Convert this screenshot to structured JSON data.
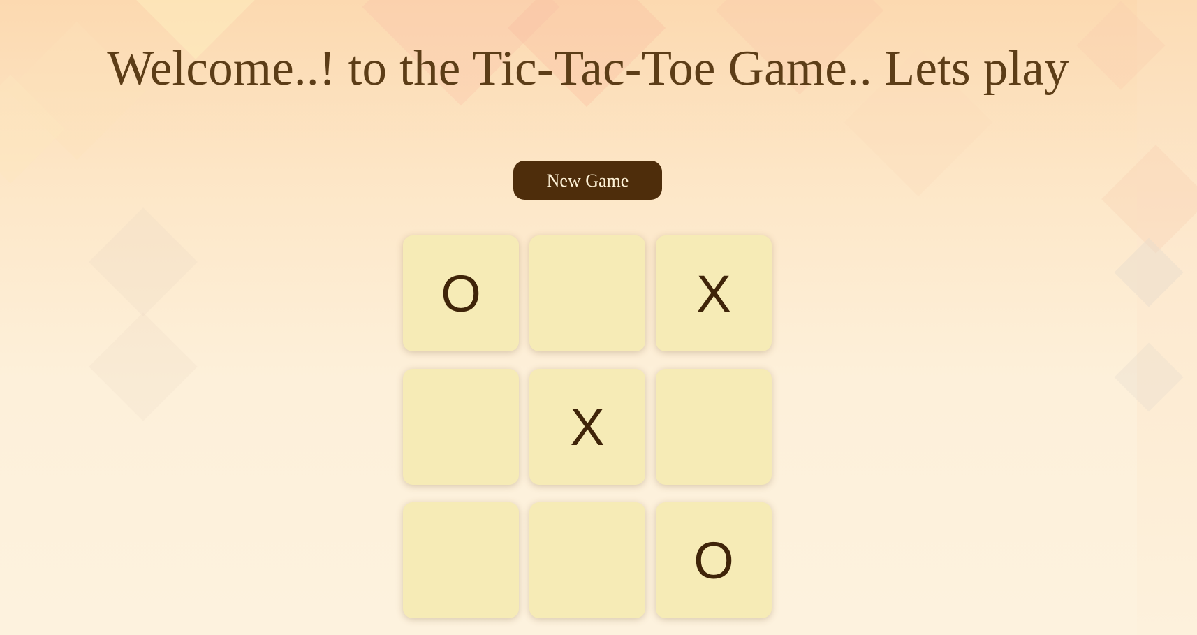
{
  "page": {
    "title": "Welcome..! to the Tic-Tac-Toe Game.. Lets play"
  },
  "controls": {
    "new_game_label": "New Game"
  },
  "board": {
    "cells": [
      "O",
      "",
      "X",
      "",
      "X",
      "",
      "",
      "",
      "O"
    ]
  },
  "colors": {
    "title_text": "#5c3d17",
    "button_bg": "#4e2d0b",
    "button_text": "#fdf1d6",
    "cell_bg": "#f6ebb6",
    "mark_color": "#3f2409"
  }
}
